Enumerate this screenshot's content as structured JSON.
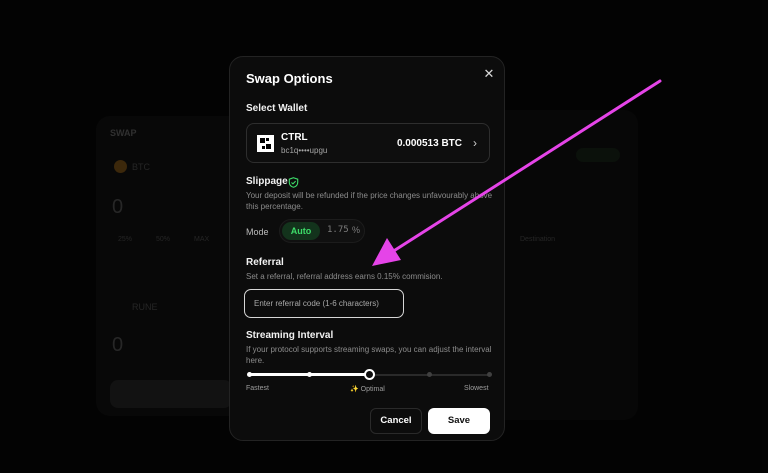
{
  "modal": {
    "title": "Swap Options",
    "close_icon": "close-icon"
  },
  "wallet": {
    "section_label": "Select Wallet",
    "name": "CTRL",
    "address": "bc1q••••upgu",
    "balance": "0.000513 BTC",
    "logo_icon": "ctrl-logo-icon",
    "chevron_icon": "chevron-right-icon"
  },
  "slippage": {
    "label": "Slippage",
    "icon": "shield-check-icon",
    "description": "Your deposit will be refunded if the price changes unfavourably above this percentage.",
    "mode_label": "Mode",
    "auto_label": "Auto",
    "value": "1.75",
    "unit": "%"
  },
  "referral": {
    "label": "Referral",
    "description": "Set a referral, referral address earns 0.15% commision.",
    "placeholder": "Enter referral code (1-6 characters)",
    "value": ""
  },
  "streaming": {
    "label": "Streaming Interval",
    "description": "If your protocol supports streaming swaps, you can adjust the interval here.",
    "steps": 5,
    "selected_step": 3,
    "labels": {
      "fastest": "Fastest",
      "optimal": "✨ Optimal",
      "slowest": "Slowest"
    }
  },
  "actions": {
    "cancel": "Cancel",
    "save": "Save"
  },
  "colors": {
    "accent_green": "#3ddc69",
    "annotation_arrow": "#e544e8"
  },
  "background": {
    "swap_title": "SWAP",
    "asset": "BTC",
    "asset2": "RUNE",
    "amount": "0",
    "amount2": "0",
    "presets": [
      "25%",
      "50%",
      "MAX"
    ],
    "destination_label": "Destination"
  }
}
